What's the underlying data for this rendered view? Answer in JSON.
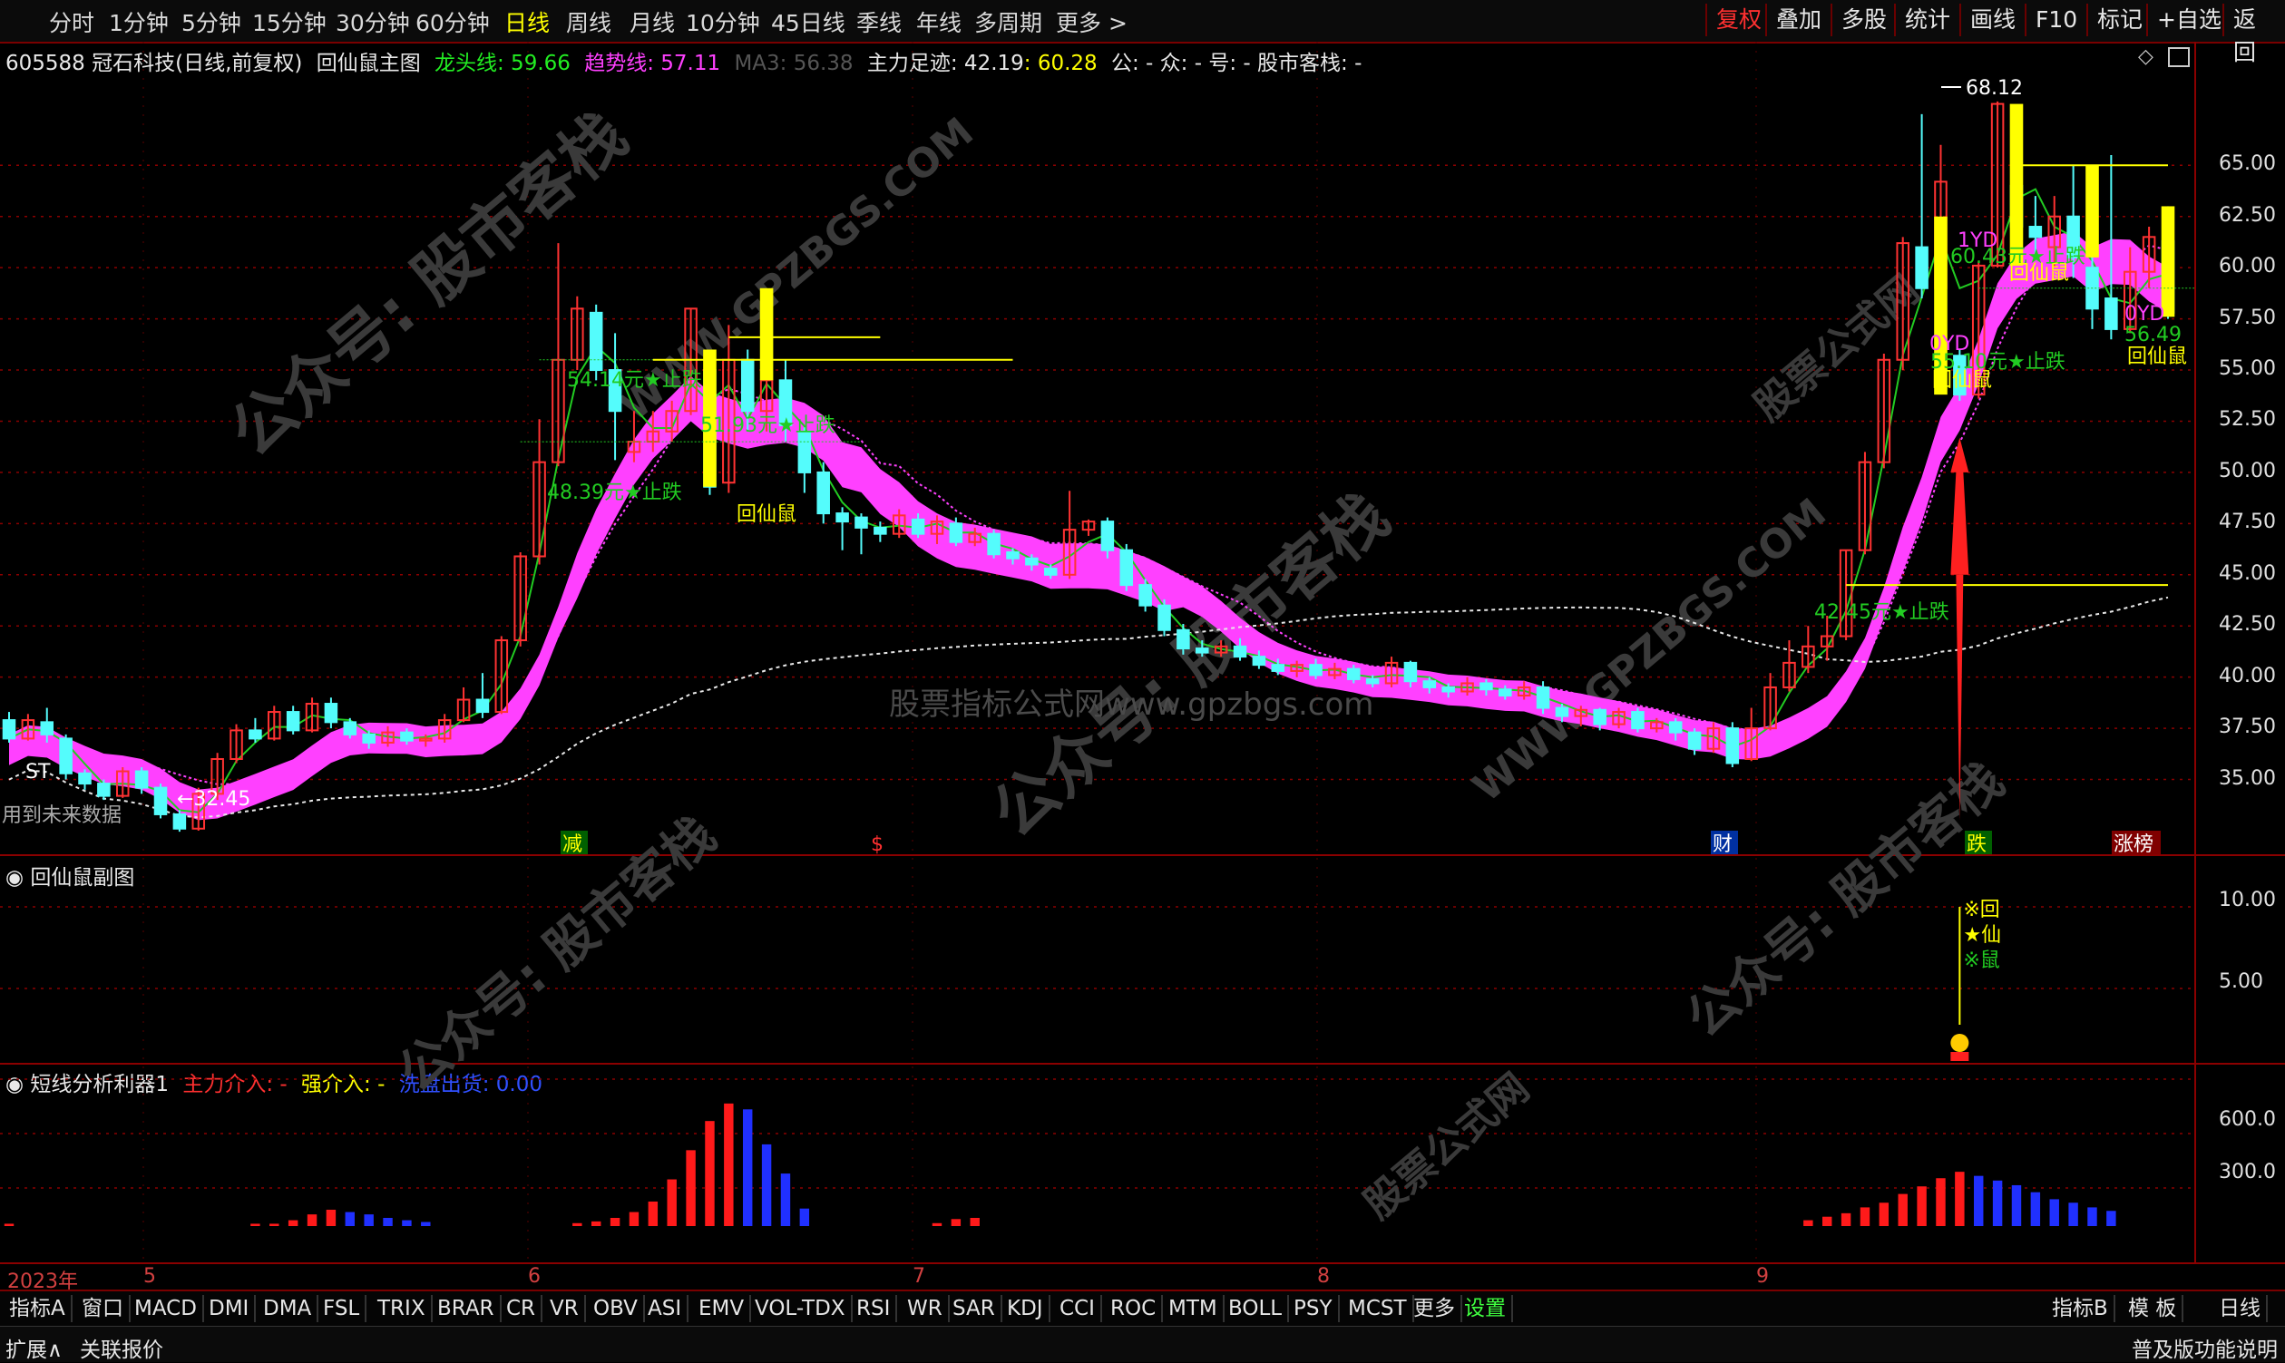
{
  "toolbar": {
    "periods": [
      "分时",
      "1分钟",
      "5分钟",
      "15分钟",
      "30分钟",
      "60分钟",
      "日线",
      "周线",
      "月线",
      "10分钟",
      "45日线",
      "季线",
      "年线",
      "多周期",
      "更多"
    ],
    "active": "日线",
    "right": [
      "复权",
      "叠加",
      "多股",
      "统计",
      "画线",
      "F10",
      "标记",
      "+自选",
      "返回"
    ]
  },
  "info": {
    "code_name": "605588 冠石科技(日线,前复权)",
    "main_indicator": "回仙鼠主图",
    "dragon_label": "龙头线: 59.66",
    "trend_label": "趋势线: 57.11",
    "ma3_label": "MA3: 56.38",
    "force_label": "主力足迹: 42.19",
    "force_value": ": 60.28",
    "extra": "公: - 众: - 号: - 股市客栈: -"
  },
  "colors": {
    "up": "#ff3232",
    "down": "#54fcfc",
    "dragon": "#ff40ff",
    "trend": "#ff40ff",
    "green": "#22cc22",
    "yellow": "#ffff00",
    "blue": "#2050ff"
  },
  "price_axis": {
    "ticks": [
      "65.00",
      "62.50",
      "60.00",
      "57.50",
      "55.00",
      "52.50",
      "50.00",
      "47.50",
      "45.00",
      "42.50",
      "40.00",
      "37.50",
      "35.00"
    ]
  },
  "sub1": {
    "title": "回仙鼠副图",
    "ticks": [
      "10.00",
      "5.00"
    ],
    "signal": [
      "※回",
      "★仙",
      "※鼠"
    ]
  },
  "sub2": {
    "title": "短线分析利器1",
    "l1": "主力介入: -",
    "l2": "强介入: -",
    "l3": "洗盘出货: 0.00",
    "ticks": [
      "600.0",
      "300.0"
    ]
  },
  "xaxis": {
    "labels": [
      "2023年",
      "5",
      "6",
      "7",
      "8",
      "9"
    ]
  },
  "annotations": {
    "st": "ST",
    "low": "←32.45",
    "high": "68.12",
    "future": "用到未来数据",
    "stop1": "54.14元★止跌",
    "stop2": "51.93元★止跌",
    "stop3": "48.39元★止跌",
    "stop4": "42.45元★止跌",
    "stop5": "55.10元★止跌",
    "stop6": "60.43元★止跌",
    "hxs": "回仙鼠",
    "yd0": "0YD",
    "yd1": "1YD",
    "v5649": "56.49",
    "flags": [
      "减",
      "$",
      "财",
      "跌",
      "涨榜"
    ],
    "watermark1": "公众号: 股市客栈",
    "watermark2": "WWW.GPZBGS.COM",
    "watermark3": "股票指标公式网www.gpzbgs.com",
    "watermark4": "股票公式网"
  },
  "bottom": {
    "items": [
      "指标A",
      "窗口",
      "MACD",
      "DMI",
      "DMA",
      "FSL",
      "TRIX",
      "BRAR",
      "CR",
      "VR",
      "OBV",
      "ASI",
      "EMV",
      "VOL-TDX",
      "RSI",
      "WR",
      "SAR",
      "KDJ",
      "CCI",
      "ROC",
      "MTM",
      "BOLL",
      "PSY",
      "MCST",
      "更多",
      "设置"
    ],
    "right": [
      "指标B",
      "模 板",
      "日线"
    ]
  },
  "status": {
    "left": [
      "扩展∧",
      "关联报价"
    ],
    "right": "普及版功能说明"
  },
  "chart_data": {
    "type": "candlestick",
    "y_range": [
      32,
      69
    ],
    "candles": [
      [
        37.9,
        37.0,
        38.3,
        36.8
      ],
      [
        37.0,
        37.9,
        38.2,
        36.9
      ],
      [
        37.8,
        37.2,
        38.5,
        36.8
      ],
      [
        37.0,
        35.3,
        37.2,
        35.0
      ],
      [
        35.3,
        34.8,
        35.5,
        34.5
      ],
      [
        34.8,
        34.2,
        35.0,
        34.0
      ],
      [
        34.2,
        35.4,
        35.6,
        34.1
      ],
      [
        35.4,
        34.6,
        35.6,
        34.3
      ],
      [
        34.6,
        33.3,
        34.8,
        33.1
      ],
      [
        33.3,
        32.6,
        33.5,
        32.45
      ],
      [
        32.6,
        34.3,
        34.6,
        32.5
      ],
      [
        34.3,
        36.0,
        36.3,
        34.0
      ],
      [
        36.0,
        37.4,
        37.7,
        35.8
      ],
      [
        37.4,
        37.0,
        38.0,
        36.8
      ],
      [
        37.0,
        38.3,
        38.6,
        36.9
      ],
      [
        38.3,
        37.4,
        38.6,
        37.2
      ],
      [
        37.4,
        38.7,
        39.0,
        37.3
      ],
      [
        38.7,
        37.8,
        39.0,
        37.5
      ],
      [
        37.8,
        37.2,
        38.0,
        37.0
      ],
      [
        37.2,
        36.8,
        37.4,
        36.5
      ],
      [
        36.8,
        37.3,
        37.6,
        36.6
      ],
      [
        37.3,
        36.9,
        37.5,
        36.7
      ],
      [
        36.9,
        37.0,
        37.2,
        36.6
      ],
      [
        37.0,
        37.9,
        38.2,
        36.8
      ],
      [
        37.9,
        38.9,
        39.5,
        37.8
      ],
      [
        38.9,
        38.3,
        40.2,
        38.0
      ],
      [
        38.3,
        41.8,
        42.0,
        38.2
      ],
      [
        41.8,
        45.9,
        46.1,
        41.5
      ],
      [
        45.9,
        50.5,
        52.6,
        45.5
      ],
      [
        50.5,
        55.5,
        61.2,
        50.3
      ],
      [
        55.5,
        58.0,
        58.6,
        55.0
      ],
      [
        57.8,
        55.0,
        58.2,
        54.5
      ],
      [
        55.0,
        53.0,
        56.8,
        50.6
      ],
      [
        51.0,
        51.5,
        53.0,
        50.5
      ],
      [
        51.5,
        52.0,
        53.0,
        51.0
      ],
      [
        52.0,
        53.0,
        53.5,
        51.5
      ],
      [
        53.0,
        58.0,
        58.0,
        52.8
      ],
      [
        55.0,
        49.3,
        55.5,
        48.9
      ],
      [
        49.5,
        55.5,
        57.2,
        49.0
      ],
      [
        55.5,
        53.0,
        56.0,
        52.0
      ],
      [
        53.0,
        54.5,
        55.0,
        52.0
      ],
      [
        54.5,
        52.3,
        55.5,
        51.5
      ],
      [
        52.0,
        50.0,
        52.2,
        49.0
      ],
      [
        50.0,
        48.0,
        50.5,
        47.5
      ],
      [
        48.0,
        47.6,
        48.3,
        46.2
      ],
      [
        47.8,
        47.3,
        48.0,
        46.0
      ],
      [
        47.3,
        47.0,
        47.6,
        46.6
      ],
      [
        47.0,
        47.9,
        48.2,
        46.8
      ],
      [
        47.7,
        47.0,
        48.0,
        46.8
      ],
      [
        47.0,
        47.6,
        47.9,
        46.5
      ],
      [
        47.5,
        46.6,
        47.8,
        46.4
      ],
      [
        46.6,
        47.0,
        47.3,
        46.4
      ],
      [
        47.0,
        46.0,
        47.2,
        45.8
      ],
      [
        46.1,
        45.8,
        46.3,
        45.5
      ],
      [
        45.8,
        45.5,
        46.0,
        45.2
      ],
      [
        45.3,
        45.0,
        45.5,
        44.8
      ],
      [
        45.0,
        47.2,
        49.1,
        44.8
      ],
      [
        47.2,
        47.6,
        47.7,
        46.9
      ],
      [
        47.6,
        46.2,
        47.8,
        45.8
      ],
      [
        46.2,
        44.5,
        46.5,
        44.2
      ],
      [
        44.5,
        43.5,
        44.8,
        43.2
      ],
      [
        43.5,
        42.3,
        43.8,
        42.0
      ],
      [
        42.3,
        41.4,
        42.6,
        41.1
      ],
      [
        41.4,
        41.2,
        41.8,
        41.0
      ],
      [
        41.2,
        41.5,
        41.8,
        41.0
      ],
      [
        41.5,
        41.0,
        41.9,
        40.8
      ],
      [
        41.0,
        40.6,
        41.3,
        40.4
      ],
      [
        40.6,
        40.3,
        40.9,
        40.1
      ],
      [
        40.3,
        40.6,
        40.8,
        40.0
      ],
      [
        40.6,
        40.1,
        40.9,
        39.9
      ],
      [
        40.1,
        40.4,
        40.7,
        39.9
      ],
      [
        40.4,
        39.9,
        40.6,
        39.7
      ],
      [
        39.9,
        39.7,
        40.1,
        39.5
      ],
      [
        39.7,
        40.7,
        41.0,
        39.5
      ],
      [
        40.7,
        39.8,
        40.8,
        39.5
      ],
      [
        39.8,
        39.5,
        40.0,
        39.2
      ],
      [
        39.5,
        39.3,
        39.7,
        39.0
      ],
      [
        39.3,
        39.7,
        40.0,
        39.1
      ],
      [
        39.7,
        39.4,
        39.9,
        39.1
      ],
      [
        39.4,
        39.1,
        39.6,
        38.9
      ],
      [
        39.1,
        39.5,
        39.8,
        38.9
      ],
      [
        39.5,
        38.5,
        39.8,
        38.2
      ],
      [
        38.5,
        38.1,
        38.7,
        37.8
      ],
      [
        38.1,
        38.4,
        38.6,
        37.6
      ],
      [
        38.4,
        37.7,
        38.5,
        37.4
      ],
      [
        37.7,
        38.3,
        38.5,
        37.5
      ],
      [
        38.3,
        37.5,
        38.5,
        37.3
      ],
      [
        37.5,
        37.8,
        38.0,
        37.3
      ],
      [
        37.8,
        37.3,
        38.0,
        36.9
      ],
      [
        37.3,
        36.5,
        37.5,
        36.2
      ],
      [
        36.5,
        37.5,
        37.8,
        36.3
      ],
      [
        37.5,
        35.8,
        37.8,
        35.6
      ],
      [
        36.0,
        37.5,
        38.5,
        35.9
      ],
      [
        37.5,
        39.5,
        40.2,
        37.4
      ],
      [
        39.5,
        40.7,
        41.8,
        39.3
      ],
      [
        40.5,
        41.5,
        42.5,
        40.2
      ],
      [
        41.5,
        42.0,
        43.0,
        40.8
      ],
      [
        42.0,
        46.2,
        46.2,
        41.8
      ],
      [
        46.2,
        50.5,
        51.0,
        46.0
      ],
      [
        50.5,
        55.5,
        55.8,
        50.2
      ],
      [
        55.5,
        61.2,
        61.5,
        55.0
      ],
      [
        61.0,
        59.0,
        67.5,
        58.5
      ],
      [
        59.0,
        64.2,
        66.0,
        58.0
      ],
      [
        55.7,
        53.8,
        56.0,
        53.5
      ],
      [
        53.8,
        60.1,
        60.3,
        53.6
      ],
      [
        60.1,
        68.0,
        68.12,
        60.0
      ],
      [
        64.0,
        62.0,
        65.8,
        61.0
      ],
      [
        62.0,
        61.5,
        63.5,
        60.5
      ],
      [
        61.0,
        62.5,
        63.5,
        60.0
      ],
      [
        62.5,
        60.5,
        65.0,
        59.5
      ],
      [
        60.0,
        58.0,
        61.5,
        57.0
      ],
      [
        58.5,
        57.0,
        65.5,
        56.5
      ],
      [
        57.0,
        59.8,
        61.0,
        56.8
      ],
      [
        59.8,
        61.5,
        62.0,
        59.0
      ],
      [
        61.3,
        57.8,
        63.0,
        57.5
      ]
    ]
  }
}
